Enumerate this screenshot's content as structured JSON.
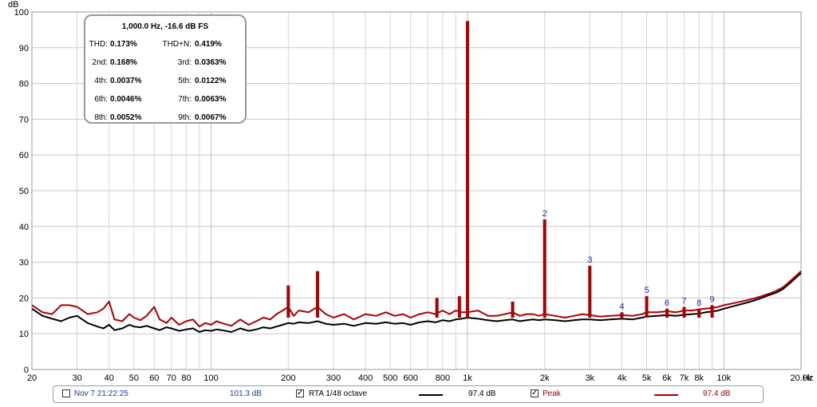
{
  "chart_data": {
    "type": "line",
    "title": "",
    "ylabel": "dB",
    "xlabel": "Hz",
    "x_scale": "log",
    "xlim": [
      20,
      20000
    ],
    "ylim": [
      0,
      100
    ],
    "grid": true,
    "y_ticks": [
      0,
      10,
      20,
      30,
      40,
      50,
      60,
      70,
      80,
      90,
      100
    ],
    "x_ticks": [
      {
        "v": 20,
        "label": "20"
      },
      {
        "v": 30,
        "label": "30"
      },
      {
        "v": 40,
        "label": "40"
      },
      {
        "v": 50,
        "label": "50"
      },
      {
        "v": 60,
        "label": "60"
      },
      {
        "v": 70,
        "label": "70"
      },
      {
        "v": 80,
        "label": "80"
      },
      {
        "v": 100,
        "label": "100"
      },
      {
        "v": 200,
        "label": "200"
      },
      {
        "v": 300,
        "label": "300"
      },
      {
        "v": 400,
        "label": "400"
      },
      {
        "v": 500,
        "label": "500"
      },
      {
        "v": 600,
        "label": "600"
      },
      {
        "v": 800,
        "label": "800"
      },
      {
        "v": 1000,
        "label": "1k"
      },
      {
        "v": 2000,
        "label": "2k"
      },
      {
        "v": 3000,
        "label": "3k"
      },
      {
        "v": 4000,
        "label": "4k"
      },
      {
        "v": 5000,
        "label": "5k"
      },
      {
        "v": 6000,
        "label": "6k"
      },
      {
        "v": 7000,
        "label": "7k"
      },
      {
        "v": 8000,
        "label": "8k"
      },
      {
        "v": 10000,
        "label": "10k"
      },
      {
        "v": 20000,
        "label": "20.0k"
      }
    ],
    "series": [
      {
        "name": "RTA 1/48 octave",
        "color": "#000000",
        "x": [
          20,
          22,
          24,
          26,
          28,
          30,
          33,
          36,
          38,
          40,
          42,
          45,
          48,
          50,
          53,
          56,
          60,
          63,
          67,
          70,
          75,
          80,
          85,
          90,
          95,
          100,
          105,
          110,
          120,
          130,
          140,
          150,
          160,
          170,
          180,
          190,
          200,
          210,
          220,
          240,
          260,
          280,
          300,
          330,
          360,
          400,
          440,
          480,
          520,
          560,
          600,
          650,
          700,
          750,
          800,
          850,
          900,
          950,
          1000,
          1100,
          1200,
          1300,
          1400,
          1500,
          1600,
          1700,
          1800,
          1900,
          2000,
          2200,
          2400,
          2600,
          2800,
          3000,
          3300,
          3600,
          4000,
          4400,
          4800,
          5000,
          5500,
          6000,
          6500,
          7000,
          7500,
          8000,
          8500,
          9000,
          9500,
          10000,
          11000,
          12000,
          13000,
          14000,
          15000,
          16000,
          17000,
          18000,
          19000,
          20000
        ],
        "values": [
          17.0,
          15.0,
          14.2,
          13.5,
          14.5,
          15.0,
          13.0,
          12.0,
          11.5,
          12.5,
          11.0,
          11.5,
          12.5,
          12.0,
          11.8,
          12.2,
          11.5,
          11.0,
          11.8,
          11.5,
          10.8,
          11.2,
          11.5,
          10.5,
          11.0,
          10.8,
          11.2,
          11.0,
          10.5,
          11.5,
          10.8,
          11.2,
          11.8,
          11.5,
          12.0,
          12.5,
          13.0,
          12.8,
          13.2,
          13.0,
          13.5,
          12.8,
          12.5,
          12.8,
          12.2,
          13.0,
          12.8,
          13.2,
          12.8,
          13.0,
          12.5,
          13.2,
          13.5,
          13.2,
          13.8,
          13.5,
          14.0,
          14.2,
          14.5,
          14.2,
          13.8,
          13.5,
          13.8,
          14.0,
          13.5,
          13.8,
          14.0,
          13.8,
          14.0,
          13.8,
          13.5,
          13.8,
          14.0,
          14.0,
          13.8,
          14.0,
          14.2,
          14.0,
          14.5,
          14.8,
          15.0,
          15.2,
          15.0,
          15.3,
          15.5,
          15.6,
          16.0,
          16.2,
          16.5,
          17.0,
          17.8,
          18.5,
          19.2,
          20.0,
          20.8,
          21.5,
          22.5,
          24.0,
          25.5,
          27.0
        ]
      },
      {
        "name": "Peak",
        "color": "#aa0000",
        "x": [
          20,
          22,
          24,
          26,
          28,
          30,
          33,
          36,
          38,
          40,
          42,
          45,
          48,
          50,
          53,
          56,
          60,
          63,
          67,
          70,
          75,
          80,
          85,
          90,
          95,
          100,
          105,
          110,
          120,
          130,
          140,
          150,
          160,
          170,
          180,
          190,
          200,
          210,
          220,
          240,
          260,
          280,
          300,
          330,
          360,
          400,
          440,
          480,
          520,
          560,
          600,
          650,
          700,
          750,
          800,
          850,
          900,
          950,
          1000,
          1100,
          1200,
          1300,
          1400,
          1500,
          1600,
          1700,
          1800,
          1900,
          2000,
          2200,
          2400,
          2600,
          2800,
          3000,
          3300,
          3600,
          4000,
          4400,
          4800,
          5000,
          5500,
          6000,
          6500,
          7000,
          7500,
          8000,
          8500,
          9000,
          9500,
          10000,
          11000,
          12000,
          13000,
          14000,
          15000,
          16000,
          17000,
          18000,
          19000,
          20000
        ],
        "values": [
          18.0,
          16.0,
          15.5,
          18.0,
          18.0,
          17.5,
          15.5,
          16.0,
          17.0,
          19.0,
          14.0,
          13.5,
          15.5,
          14.5,
          13.8,
          15.0,
          17.5,
          14.0,
          13.0,
          14.5,
          12.5,
          13.5,
          14.0,
          12.0,
          13.0,
          12.5,
          13.5,
          13.0,
          12.2,
          14.0,
          12.5,
          13.5,
          14.5,
          14.0,
          15.5,
          16.5,
          17.5,
          15.0,
          16.5,
          16.0,
          17.5,
          15.5,
          14.5,
          15.5,
          14.0,
          15.5,
          15.0,
          16.0,
          15.0,
          15.5,
          14.5,
          15.5,
          16.0,
          15.5,
          16.5,
          15.5,
          16.5,
          16.0,
          16.0,
          16.5,
          15.0,
          15.0,
          15.5,
          16.0,
          15.0,
          15.5,
          15.5,
          15.0,
          15.5,
          15.0,
          14.5,
          15.0,
          15.5,
          15.2,
          14.8,
          15.0,
          15.2,
          15.0,
          15.5,
          16.0,
          16.0,
          16.3,
          16.0,
          16.5,
          16.5,
          16.8,
          17.0,
          17.2,
          17.5,
          18.0,
          18.6,
          19.2,
          19.8,
          20.5,
          21.2,
          22.0,
          23.0,
          24.5,
          26.0,
          27.5
        ]
      }
    ],
    "peaks": [
      {
        "x": 1000,
        "y": 97.5,
        "label": ""
      },
      {
        "x": 2000,
        "y": 42.0,
        "label": "2"
      },
      {
        "x": 3000,
        "y": 29.0,
        "label": "3"
      },
      {
        "x": 4000,
        "y": 16.0,
        "label": "4"
      },
      {
        "x": 5000,
        "y": 20.5,
        "label": "5"
      },
      {
        "x": 6000,
        "y": 17.0,
        "label": "6"
      },
      {
        "x": 7000,
        "y": 17.5,
        "label": "7"
      },
      {
        "x": 8000,
        "y": 17.0,
        "label": "8"
      },
      {
        "x": 9000,
        "y": 18.0,
        "label": "9"
      },
      {
        "x": 200,
        "y": 23.5,
        "label": ""
      },
      {
        "x": 260,
        "y": 27.5,
        "label": ""
      },
      {
        "x": 930,
        "y": 20.5,
        "label": ""
      },
      {
        "x": 1500,
        "y": 19.0,
        "label": ""
      },
      {
        "x": 760,
        "y": 20.0,
        "label": ""
      }
    ]
  },
  "info_box": {
    "header": "1,000.0 Hz, -16.6 dB FS",
    "rows": [
      {
        "l1": "THD:",
        "v1": "0.173%",
        "l2": "THD+N:",
        "v2": "0.419%"
      },
      {
        "l1": "2nd:",
        "v1": "0.168%",
        "l2": "3rd:",
        "v2": "0.0363%"
      },
      {
        "l1": "4th:",
        "v1": "0.0037%",
        "l2": "5th:",
        "v2": "0.0122%"
      },
      {
        "l1": "6th:",
        "v1": "0.0046%",
        "l2": "7th:",
        "v2": "0.0063%"
      },
      {
        "l1": "8th:",
        "v1": "0.0052%",
        "l2": "9th:",
        "v2": "0.0067%"
      }
    ]
  },
  "legend": {
    "date_label": "Nov 7 21:22:25",
    "date_value": "101.3 dB",
    "date_checked": false,
    "rta_label": "RTA 1/48 octave",
    "rta_value": "97.4 dB",
    "rta_checked": true,
    "peak_label": "Peak",
    "peak_value": "97.4 dB",
    "peak_checked": true,
    "check_glyph": "✓",
    "date_color": "#1a3aa8",
    "rta_color": "#000000",
    "peak_color": "#aa0000"
  }
}
